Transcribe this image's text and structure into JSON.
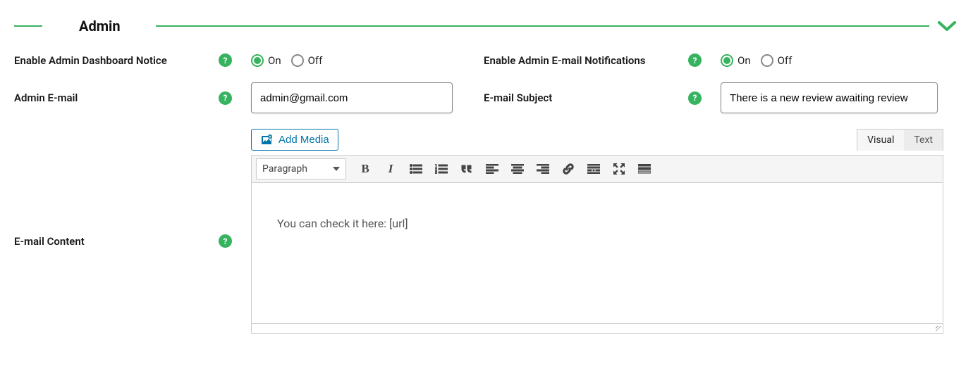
{
  "section": {
    "title": "Admin"
  },
  "fields": {
    "dashboard_notice": {
      "label": "Enable Admin Dashboard Notice",
      "value": "On"
    },
    "email_notifications": {
      "label": "Enable Admin E-mail Notifications",
      "value": "On"
    },
    "admin_email": {
      "label": "Admin E-mail",
      "value": "admin@gmail.com"
    },
    "email_subject": {
      "label": "E-mail Subject",
      "value": "There is a new review awaiting review"
    },
    "email_content": {
      "label": "E-mail Content",
      "value": "You can check it here: [url]"
    }
  },
  "radio_options": {
    "on": "On",
    "off": "Off"
  },
  "editor": {
    "add_media_label": "Add Media",
    "tabs": {
      "visual": "Visual",
      "text": "Text",
      "active": "visual"
    },
    "format_selected": "Paragraph"
  }
}
